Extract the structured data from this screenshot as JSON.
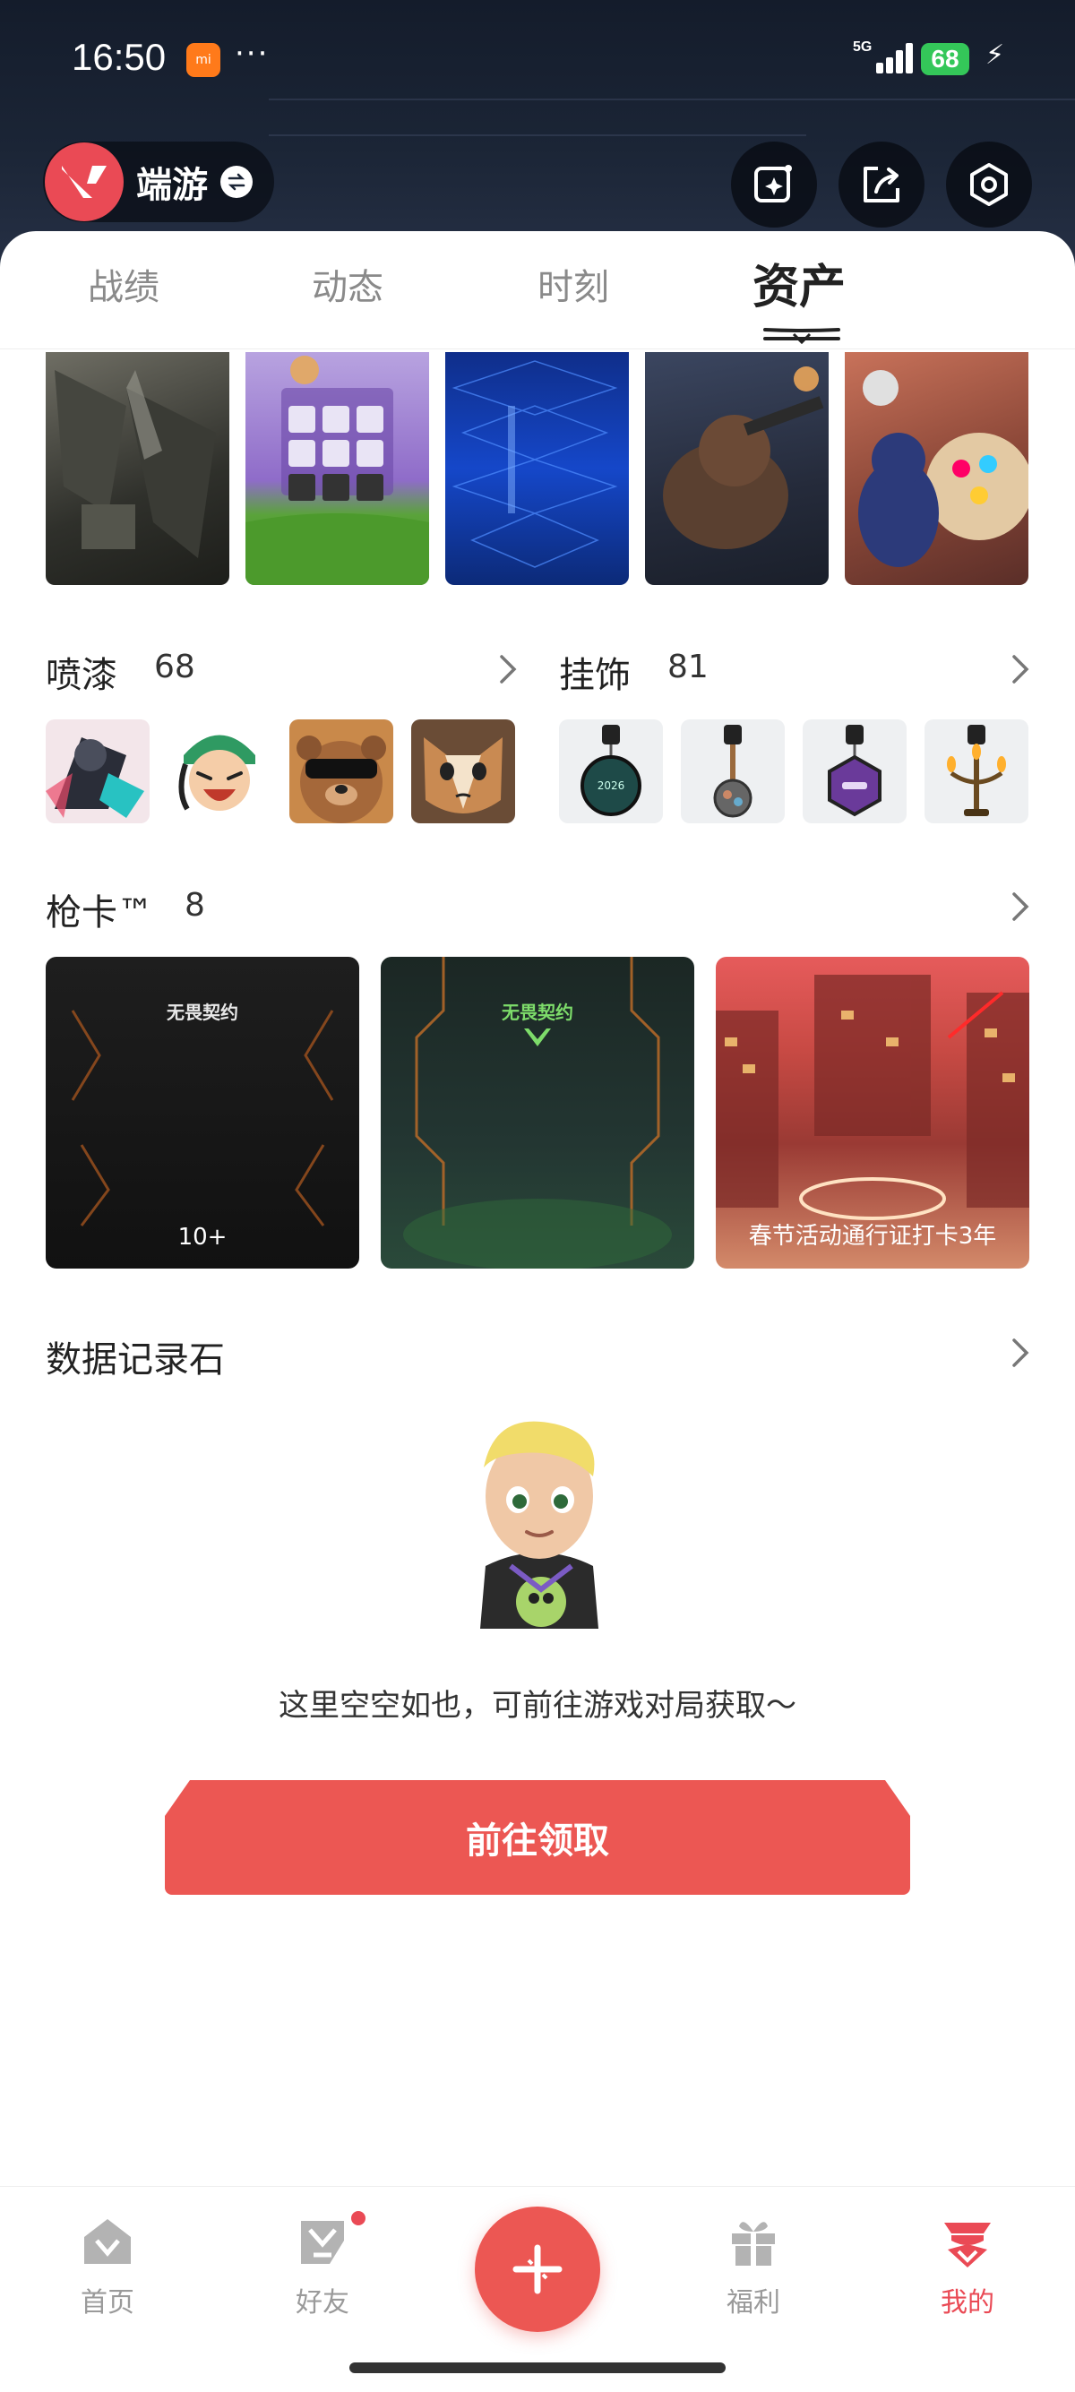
{
  "status_bar": {
    "time": "16:50",
    "app_badge": "mi",
    "network": "5G",
    "battery": "68",
    "more": "···"
  },
  "header": {
    "game_name": "端游",
    "actions": [
      "editor-icon",
      "share-icon",
      "settings-icon"
    ]
  },
  "tabs": [
    {
      "label": "战绩",
      "active": false
    },
    {
      "label": "动态",
      "active": false
    },
    {
      "label": "时刻",
      "active": false
    },
    {
      "label": "资产",
      "active": true
    }
  ],
  "sprays": {
    "title": "喷漆",
    "count": "68"
  },
  "charms": {
    "title": "挂饰",
    "count": "81"
  },
  "gun_cards": {
    "title": "枪卡™",
    "count": "8",
    "cards": [
      {
        "logo": "无畏契约",
        "caption": "10+"
      },
      {
        "logo": "无畏契约",
        "caption": ""
      },
      {
        "logo": "",
        "caption": "春节活动通行证打卡3年"
      }
    ]
  },
  "data_stone": {
    "title": "数据记录石",
    "empty_text": "这里空空如也，可前往游戏对局获取～",
    "cta_label": "前往领取"
  },
  "bottom_nav": [
    {
      "label": "首页",
      "icon": "home-icon",
      "active": false
    },
    {
      "label": "好友",
      "icon": "friends-icon",
      "active": false,
      "badge": true
    },
    {
      "label": "",
      "icon": "plus-icon",
      "active": false
    },
    {
      "label": "福利",
      "icon": "gift-icon",
      "active": false
    },
    {
      "label": "我的",
      "icon": "profile-icon",
      "active": true
    }
  ],
  "colors": {
    "accent": "#ec5753",
    "active_nav": "#ea4a55",
    "header_bg": "#1b2536"
  }
}
